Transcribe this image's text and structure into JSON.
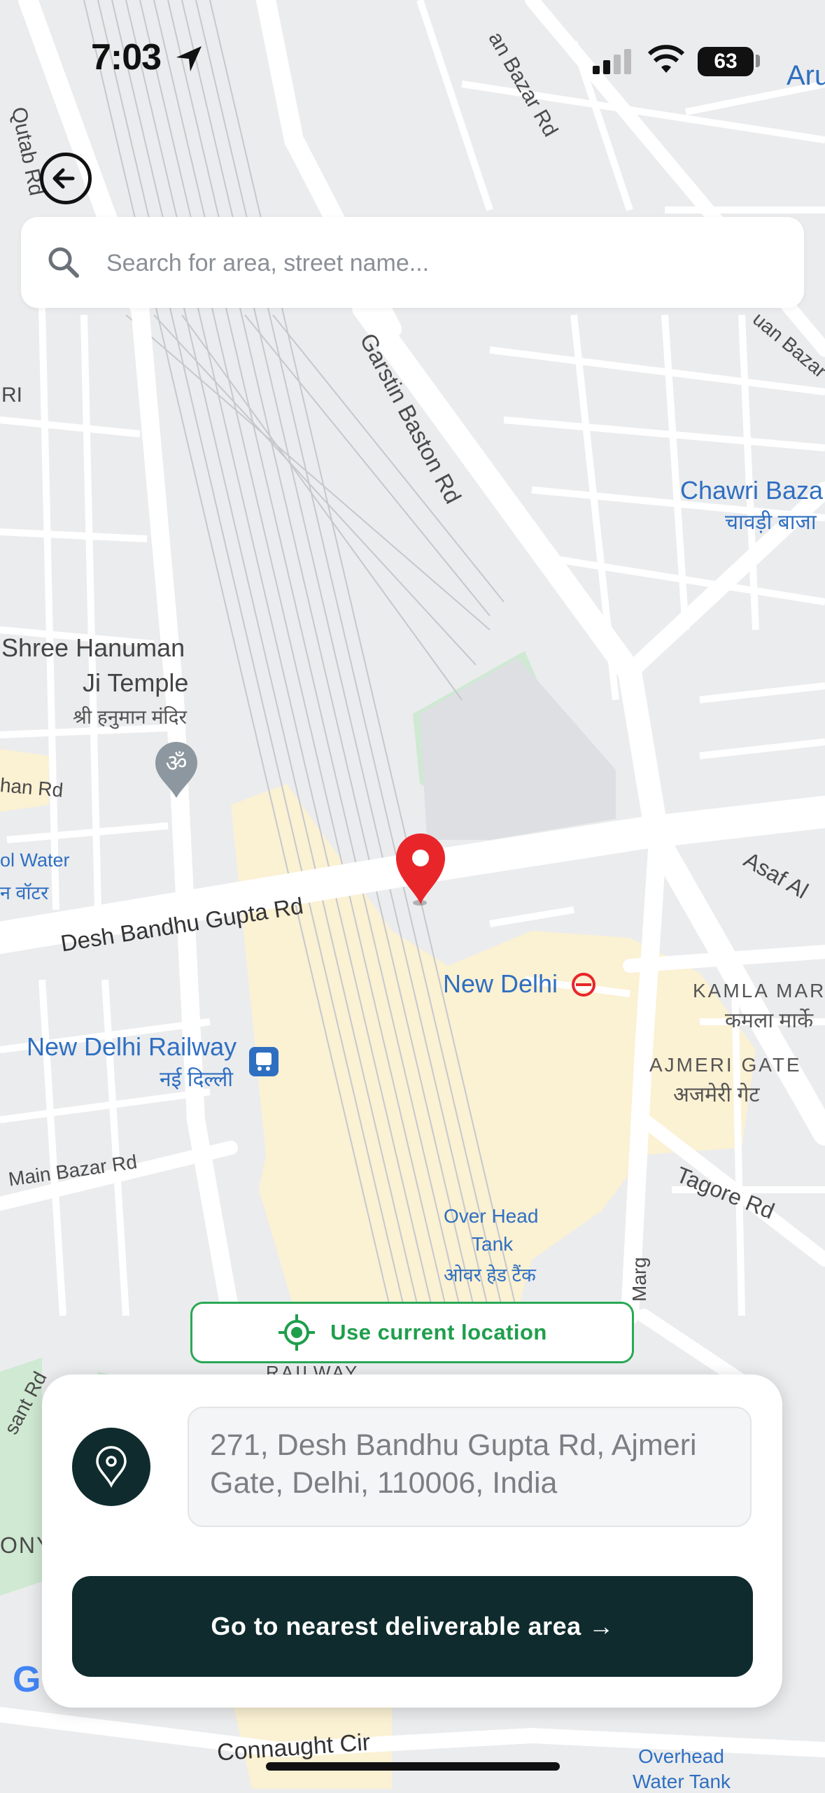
{
  "status": {
    "time": "7:03",
    "battery": "63",
    "partial_label": "Aru"
  },
  "search": {
    "placeholder": "Search for area, street name..."
  },
  "map": {
    "labels": {
      "qutab_rd": "Qutab Rd",
      "garstin": "Garstin Baston Rd",
      "chawri": "Chawri Baza",
      "chawri_hi": "चावड़ी बाजा",
      "hanuman1": "Shree Hanuman",
      "hanuman2": "Ji Temple",
      "hanuman_hi": "श्री हनुमान मंदिर",
      "desh_bandhu": "Desh Bandhu Gupta Rd",
      "new_delhi": "New Delhi",
      "railway": "New Delhi Railway",
      "railway_hi": "नई दिल्ली",
      "kamla": "KAMLA MAR",
      "kamla_hi": "कमला मार्के",
      "ajmeri": "AJMERI GATE",
      "ajmeri_hi": "अजमेरी गेट",
      "tagore": "Tagore Rd",
      "asaf": "Asaf Al",
      "main_bazar": "Main Bazar Rd",
      "overhead1": "Over Head",
      "overhead2": "Tank",
      "overhead_hi": "ओवर हेड टैंक",
      "connaught": "Connaught Cir",
      "overhead_b1": "Overhead",
      "overhead_b2": "Water Tank",
      "bazar_rd": "an Bazar Rd",
      "ri": "RI",
      "han_rd": "han Rd",
      "ol_water": "ol Water",
      "water_hi": "न वॉटर",
      "uan_bazar": "uan Bazar Rc",
      "railway_caps": "RAILWAY",
      "sant_rd": "sant Rd",
      "ony": "ONY",
      "marg": "Marg"
    }
  },
  "use_location": {
    "label": "Use current location"
  },
  "sheet": {
    "address": "271, Desh Bandhu Gupta Rd, Ajmeri Gate, Delhi, 110006, India",
    "cta_label": "Go to nearest deliverable area →"
  },
  "colors": {
    "accent_dark": "#0f2b2d",
    "accent_green": "#1f9e4c",
    "pin_red": "#e8262a"
  }
}
